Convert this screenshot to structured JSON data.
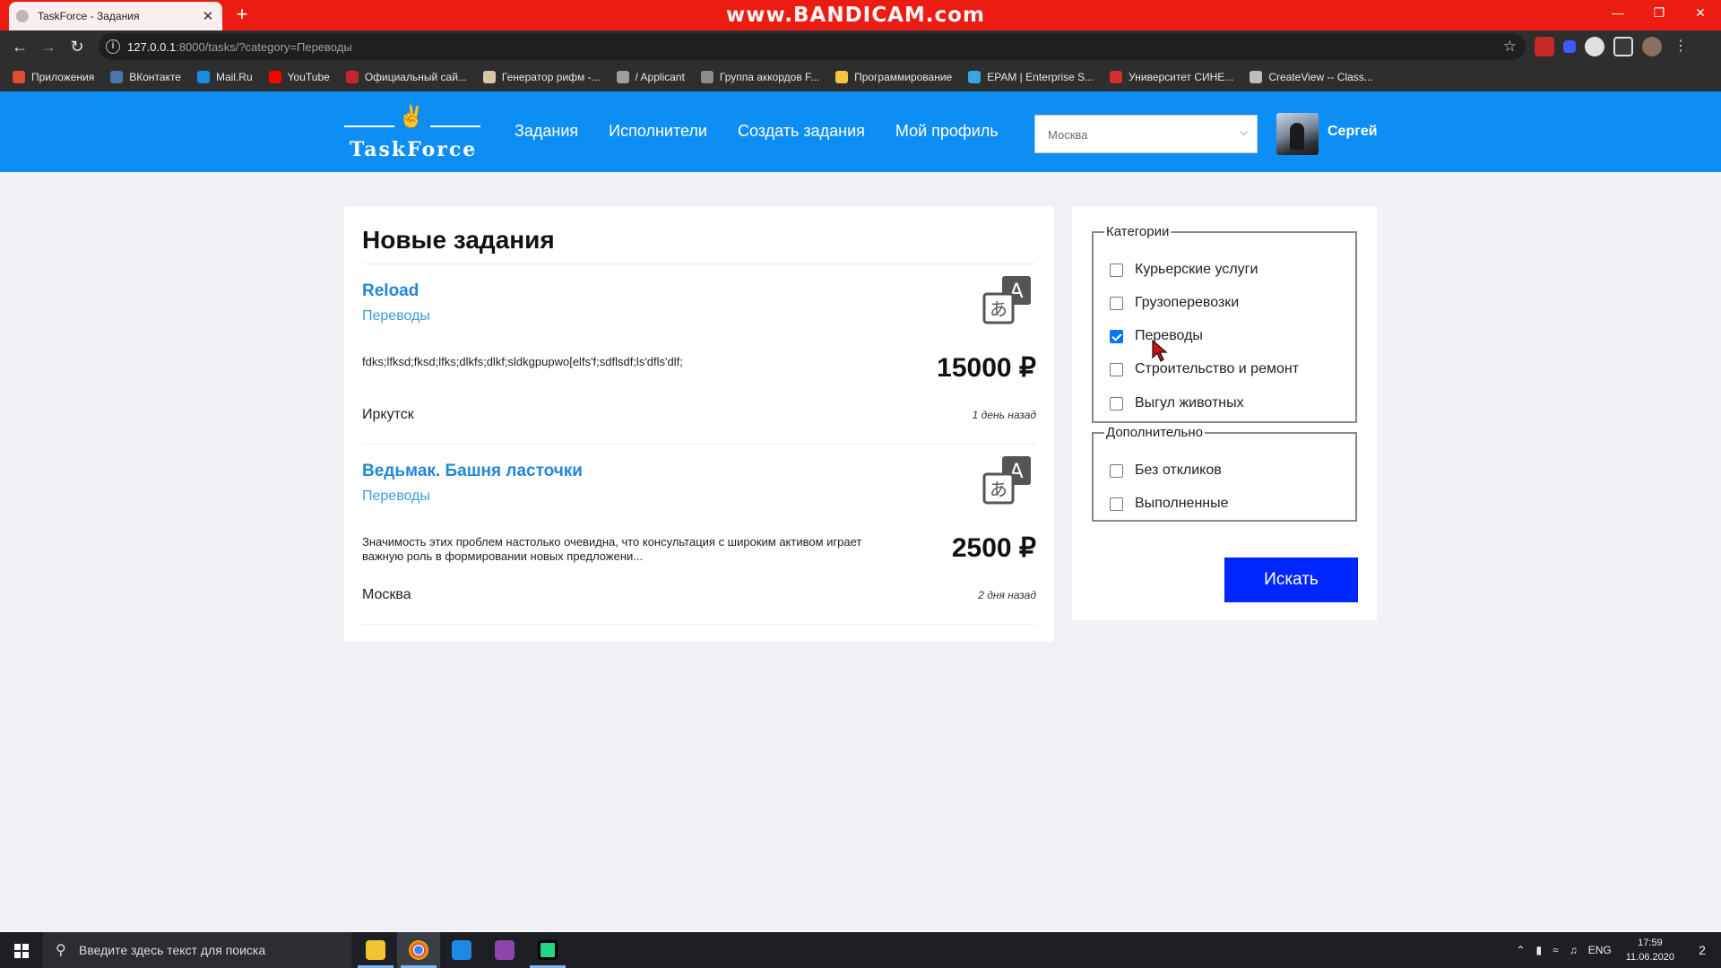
{
  "browser": {
    "tab_title": "TaskForce - Задания",
    "tab_close": "✕",
    "new_tab": "+",
    "watermark": "www.BANDICAM.com",
    "url_host": "127.0.0.1",
    "url_rest": ":8000/tasks/?category=Переводы",
    "bookmarks": [
      {
        "label": "Приложения",
        "color": "#e44b35"
      },
      {
        "label": "ВКонтакте",
        "color": "#4a76a8"
      },
      {
        "label": "Mail.Ru",
        "color": "#168de2"
      },
      {
        "label": "YouTube",
        "color": "#ff0000"
      },
      {
        "label": "Официальный сай...",
        "color": "#c6262e"
      },
      {
        "label": "Генератор рифм -...",
        "color": "#d7c8a8"
      },
      {
        "label": "/ Applicant",
        "color": "#9e9e9e"
      },
      {
        "label": "Группа аккордов F...",
        "color": "#8c8c8c"
      },
      {
        "label": "Программирование",
        "color": "#f6c342"
      },
      {
        "label": "EPAM | Enterprise S...",
        "color": "#39a7e2"
      },
      {
        "label": "Университет СИНЕ...",
        "color": "#d62f2f"
      },
      {
        "label": "CreateView -- Class...",
        "color": "#bdbdbd"
      }
    ]
  },
  "site": {
    "logo": "TaskForce",
    "menu": [
      "Задания",
      "Исполнители",
      "Создать задания",
      "Мой профиль"
    ],
    "city_select": "Москва",
    "user_name": "Сергей"
  },
  "main": {
    "title": "Новые задания",
    "tasks": [
      {
        "title": "Reload",
        "category": "Переводы",
        "description": "fdks;lfksd;fksd;lfks;dlkfs;dlkf;sldkgpupwo[elfs'f;sdflsdf;ls'dfls'dlf;",
        "price": "15000 ₽",
        "city": "Иркутск",
        "time": "1 день назад"
      },
      {
        "title": "Ведьмак. Башня ласточки",
        "category": "Переводы",
        "description": "Значимость этих проблем настолько очевидна, что консультация с широким активом играет важную роль в формировании новых предложени...",
        "price": "2500 ₽",
        "city": "Москва",
        "time": "2 дня назад"
      }
    ]
  },
  "filters": {
    "categories_legend": "Категории",
    "categories": [
      {
        "label": "Курьерские услуги",
        "checked": false
      },
      {
        "label": "Грузоперевозки",
        "checked": false
      },
      {
        "label": "Переводы",
        "checked": true
      },
      {
        "label": "Строительство и ремонт",
        "checked": false
      },
      {
        "label": "Выгул животных",
        "checked": false
      }
    ],
    "extra_legend": "Дополнительно",
    "extra": [
      {
        "label": "Без откликов",
        "checked": false
      },
      {
        "label": "Выполненные",
        "checked": false
      }
    ],
    "search_button": "Искать"
  },
  "taskbar": {
    "search_placeholder": "Введите здесь текст для поиска",
    "lang": "ENG",
    "time": "17:59",
    "date": "11.06.2020",
    "notifications": "2"
  },
  "colors": {
    "header_bg": "#0c8ef5",
    "link": "#2287d6",
    "search_button": "#0026ff",
    "checkbox_checked": "#0075ff"
  }
}
